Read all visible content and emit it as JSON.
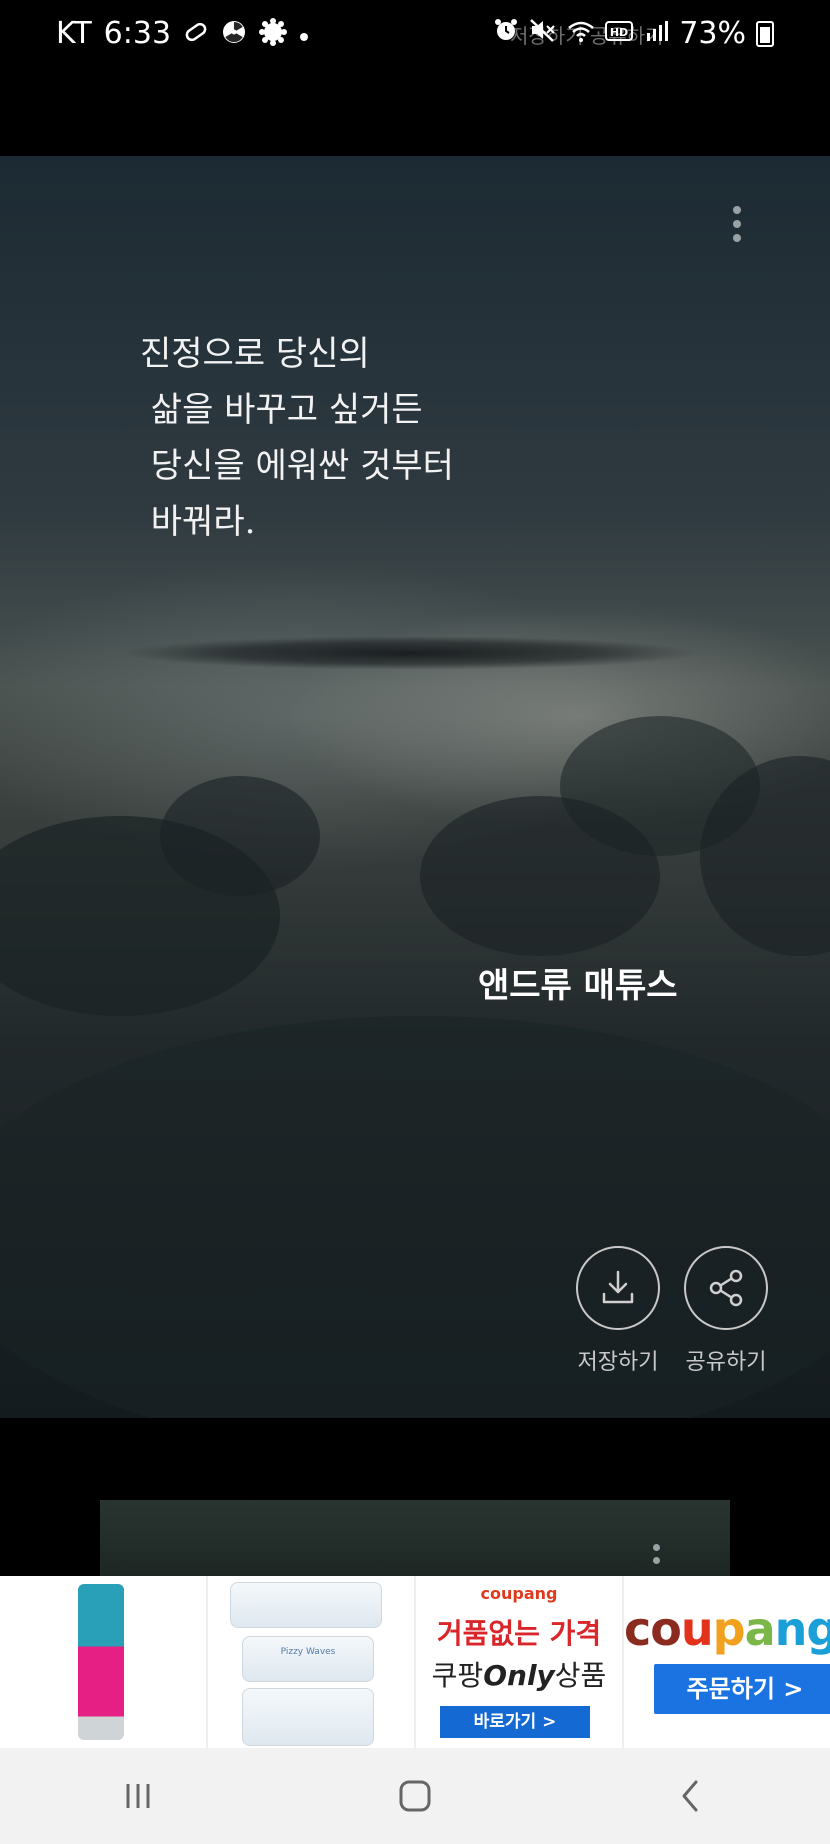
{
  "status_bar": {
    "carrier": "KT",
    "time": "6:33",
    "battery": "73%",
    "ghost_text": "저장하기  공유하기",
    "left_icons": [
      "pill-icon",
      "radiation-icon",
      "gear-badge-icon",
      "dot-icon"
    ],
    "right_icons": [
      "alarm-icon",
      "mute-icon",
      "wifi-icon",
      "hd-icon",
      "signal-icon",
      "battery-icon"
    ]
  },
  "quote_card": {
    "quote_lines": [
      "진정으로 당신의",
      " 삶을 바꾸고 싶거든",
      " 당신을 에워싼 것부터",
      " 바꿔라."
    ],
    "author": "앤드류 매튜스",
    "save_label": "저장하기",
    "share_label": "공유하기",
    "menu_icon": "more-vert-icon"
  },
  "ad_banner": {
    "slots": [
      {
        "type": "product",
        "icon": "product-tube-image"
      },
      {
        "type": "product",
        "icon": "wet-wipes-image",
        "product_label": "Pizzy Waves"
      },
      {
        "type": "promo",
        "logo": "coupang",
        "headline": "거품없는 가격",
        "sub_prefix": "쿠팡",
        "sub_emph": "Only",
        "sub_suffix": "상품",
        "button": "바로가기 >"
      },
      {
        "type": "brand",
        "logo_letters": [
          "c",
          "o",
          "u",
          "p",
          "a",
          "n",
          "g"
        ],
        "logo_colors": [
          "#8b2a1e",
          "#8b2a1e",
          "#e2321c",
          "#f2a11e",
          "#7ab648",
          "#1a9fd8",
          "#1a9fd8"
        ],
        "button": "주문하기 >"
      }
    ]
  },
  "nav_bar": {
    "recents_icon": "recents-icon",
    "home_icon": "home-icon",
    "back_icon": "back-icon"
  }
}
